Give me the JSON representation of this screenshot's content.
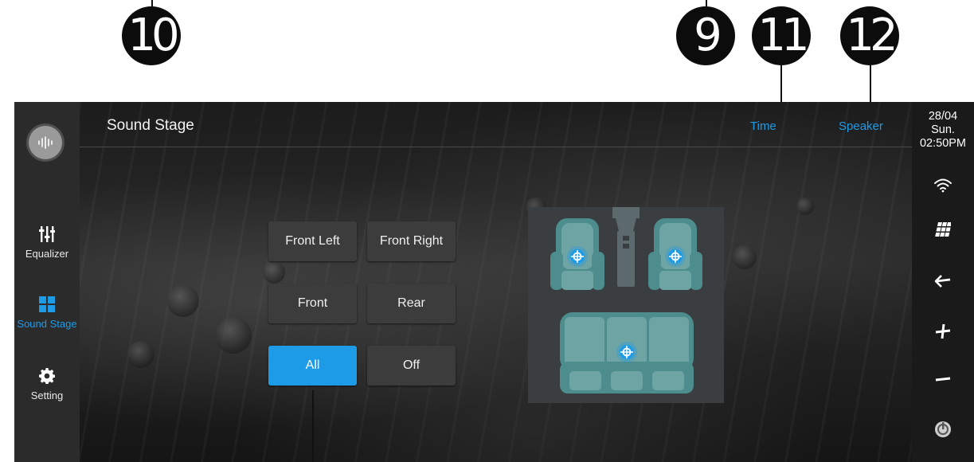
{
  "callouts": {
    "c10": "10",
    "c9": "9",
    "c11": "11",
    "c12": "12"
  },
  "header": {
    "title": "Sound Stage",
    "time_label": "Time",
    "speaker_label": "Speaker"
  },
  "sidebar": {
    "logo": "sound-wave-icon",
    "items": [
      {
        "label": "Equalizer",
        "icon": "equalizer-sliders-icon"
      },
      {
        "label": "Sound Stage",
        "icon": "grid-icon",
        "active": true
      },
      {
        "label": "Setting",
        "icon": "gear-icon"
      }
    ]
  },
  "stage_buttons": {
    "front_left": "Front Left",
    "front_right": "Front Right",
    "front": "Front",
    "rear": "Rear",
    "all": "All",
    "off": "Off",
    "selected": "All"
  },
  "seat_map": {
    "targets": [
      "front-left-seat-target",
      "front-right-seat-target",
      "rear-seat-target"
    ]
  },
  "status": {
    "date": "28/04",
    "day": "Sun.",
    "time": "02:50PM"
  },
  "right_rail_icons": [
    "wifi-icon",
    "apps-icon",
    "back-arrow-icon",
    "volume-up-icon",
    "volume-down-icon",
    "power-icon"
  ],
  "colors": {
    "accent": "#1e9be6",
    "button": "#3c3c3c",
    "rail": "#2b2b2b"
  }
}
